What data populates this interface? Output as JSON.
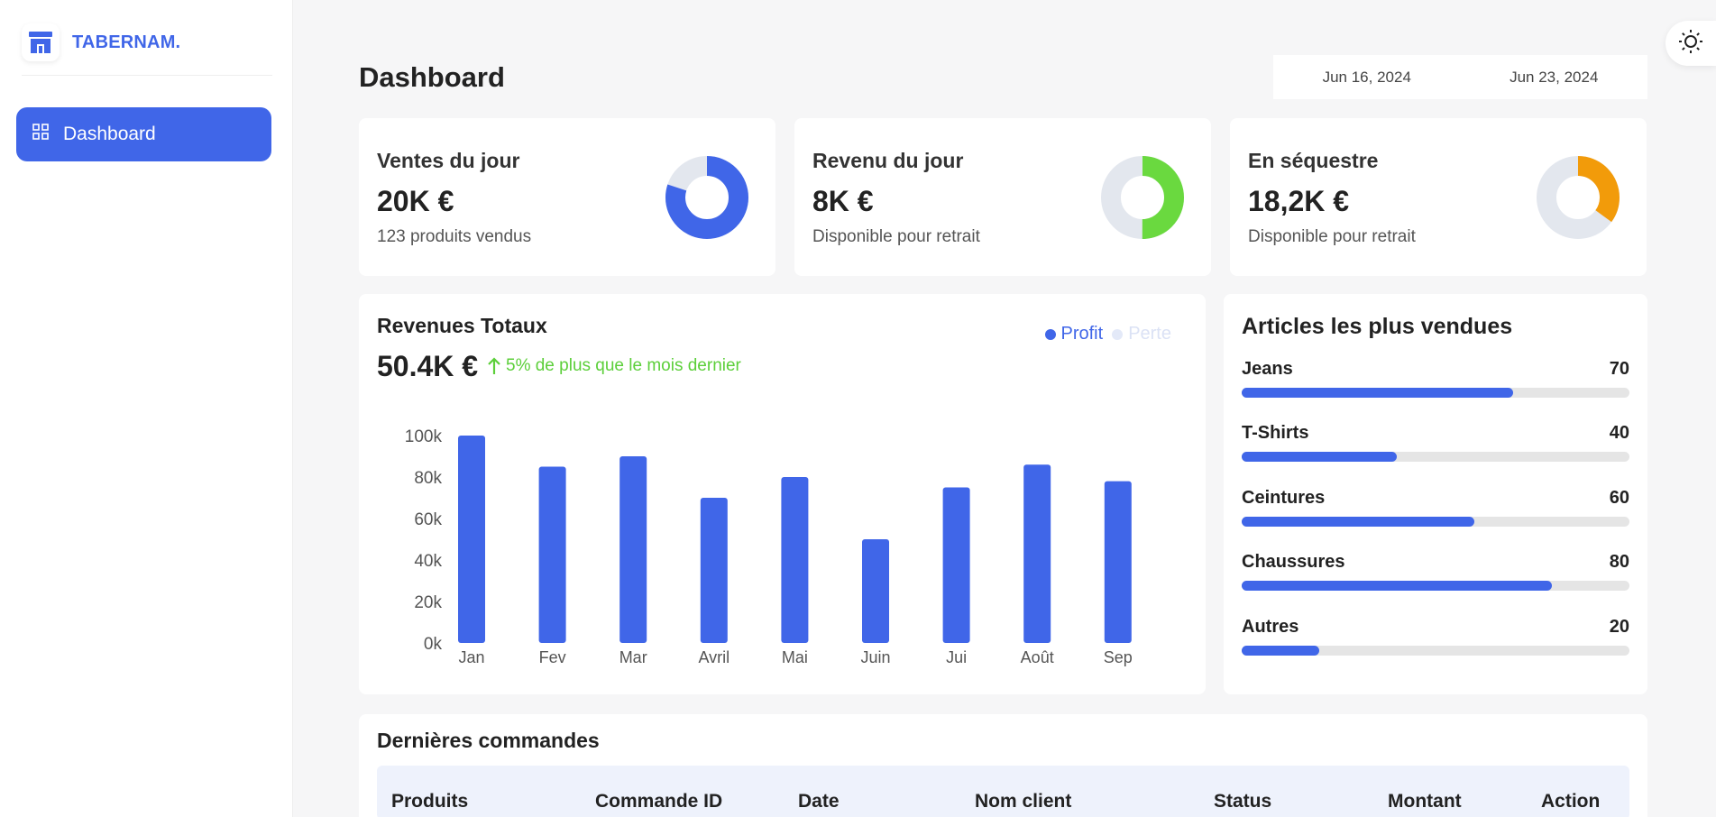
{
  "brand": {
    "name": "TABERNAM."
  },
  "sidebar": {
    "items": [
      {
        "label": "Dashboard"
      }
    ]
  },
  "header": {
    "title": "Dashboard"
  },
  "date_range": {
    "start": "Jun 16, 2024",
    "end": "Jun 23, 2024"
  },
  "colors": {
    "accent": "#4066e8",
    "green": "#6ad93f",
    "orange": "#f29b0a",
    "track": "#e3e7ee"
  },
  "stats": [
    {
      "title": "Ventes du jour",
      "value": "20K €",
      "sub": "123 produits vendus",
      "ratio": 0.8,
      "color": "#4066e8"
    },
    {
      "title": "Revenu du jour",
      "value": "8K €",
      "sub": "Disponible pour retrait",
      "ratio": 0.5,
      "color": "#6ad93f"
    },
    {
      "title": "En séquestre",
      "value": "18,2K €",
      "sub": "Disponible pour retrait",
      "ratio": 0.35,
      "color": "#f29b0a"
    }
  ],
  "revenue": {
    "title": "Revenues Totaux",
    "value": "50.4K €",
    "trend": "5% de plus que le mois dernier",
    "legend": {
      "profit": "Profit",
      "loss": "Perte"
    }
  },
  "chart_data": {
    "type": "bar",
    "categories": [
      "Jan",
      "Fev",
      "Mar",
      "Avril",
      "Mai",
      "Juin",
      "Jui",
      "Août",
      "Sep"
    ],
    "series": [
      {
        "name": "Profit",
        "values": [
          100,
          85,
          90,
          70,
          80,
          50,
          75,
          86,
          78
        ]
      }
    ],
    "yticks": [
      "0k",
      "20k",
      "40k",
      "60k",
      "80k",
      "100k"
    ],
    "ylim": [
      0,
      100
    ],
    "title": "",
    "xlabel": "",
    "ylabel": ""
  },
  "top_items": {
    "title": "Articles les plus vendues",
    "items": [
      {
        "name": "Jeans",
        "value": "70",
        "pct": 0.7
      },
      {
        "name": "T-Shirts",
        "value": "40",
        "pct": 0.4
      },
      {
        "name": "Ceintures",
        "value": "60",
        "pct": 0.6
      },
      {
        "name": "Chaussures",
        "value": "80",
        "pct": 0.8
      },
      {
        "name": "Autres",
        "value": "20",
        "pct": 0.2
      }
    ]
  },
  "orders": {
    "title": "Dernières commandes",
    "columns": [
      "Produits",
      "Commande ID",
      "Date",
      "Nom client",
      "Status",
      "Montant",
      "Action"
    ]
  }
}
